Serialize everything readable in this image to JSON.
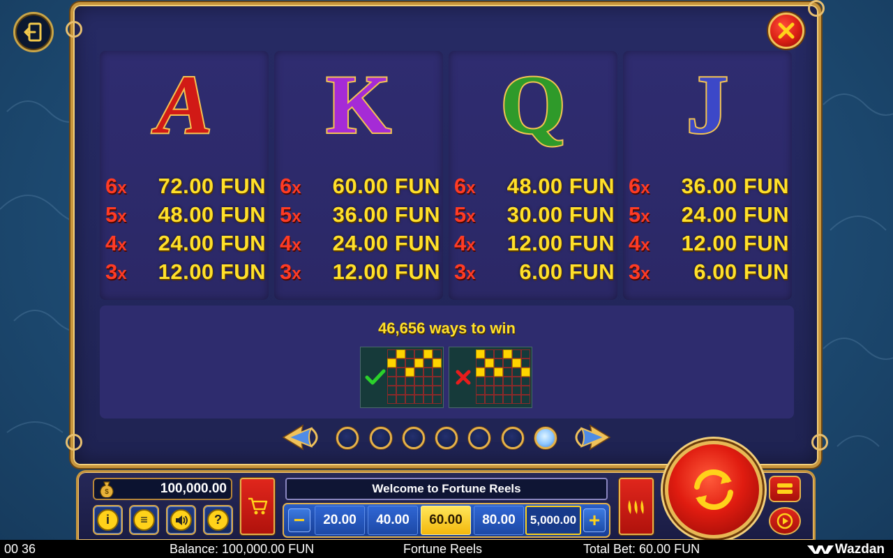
{
  "paytable": {
    "symbols": [
      {
        "name": "A",
        "color": "#d11a16",
        "gold": "#f5c451",
        "pays": [
          {
            "mult": "6",
            "amount": "72.00 FUN"
          },
          {
            "mult": "5",
            "amount": "48.00 FUN"
          },
          {
            "mult": "4",
            "amount": "24.00 FUN"
          },
          {
            "mult": "3",
            "amount": "12.00 FUN"
          }
        ]
      },
      {
        "name": "K",
        "color": "#a52bd6",
        "gold": "#f5c451",
        "pays": [
          {
            "mult": "6",
            "amount": "60.00 FUN"
          },
          {
            "mult": "5",
            "amount": "36.00 FUN"
          },
          {
            "mult": "4",
            "amount": "24.00 FUN"
          },
          {
            "mult": "3",
            "amount": "12.00 FUN"
          }
        ]
      },
      {
        "name": "Q",
        "color": "#2f9a2a",
        "gold": "#f5c451",
        "pays": [
          {
            "mult": "6",
            "amount": "48.00 FUN"
          },
          {
            "mult": "5",
            "amount": "30.00 FUN"
          },
          {
            "mult": "4",
            "amount": "12.00 FUN"
          },
          {
            "mult": "3",
            "amount": "6.00 FUN"
          }
        ]
      },
      {
        "name": "J",
        "color": "#3c48c8",
        "gold": "#f5c451",
        "pays": [
          {
            "mult": "6",
            "amount": "36.00 FUN"
          },
          {
            "mult": "5",
            "amount": "24.00 FUN"
          },
          {
            "mult": "4",
            "amount": "12.00 FUN"
          },
          {
            "mult": "3",
            "amount": "6.00 FUN"
          }
        ]
      }
    ],
    "mult_suffix": "x",
    "ways_text": "46,656 ways to win",
    "example_valid_icon": "check-icon",
    "example_invalid_icon": "cross-icon"
  },
  "pager": {
    "page_count": 7,
    "active_page": 7
  },
  "controls": {
    "balance": "100,000.00",
    "message": "Welcome to Fortune Reels",
    "bet_options": [
      "20.00",
      "40.00",
      "60.00",
      "80.00",
      "5,000.00"
    ],
    "selected_bet": "60.00",
    "minus": "−",
    "plus": "+",
    "info": "i",
    "menu": "≡",
    "help": "?"
  },
  "status": {
    "clock": "00 36",
    "balance": "Balance: 100,000.00 FUN",
    "game": "Fortune Reels",
    "total_bet": "Total Bet: 60.00 FUN",
    "brand": "Wazdan"
  },
  "colors": {
    "mult_red": "#ff3b24",
    "pay_yellow": "#ffe02a",
    "frame_gold": "#c8963c"
  }
}
